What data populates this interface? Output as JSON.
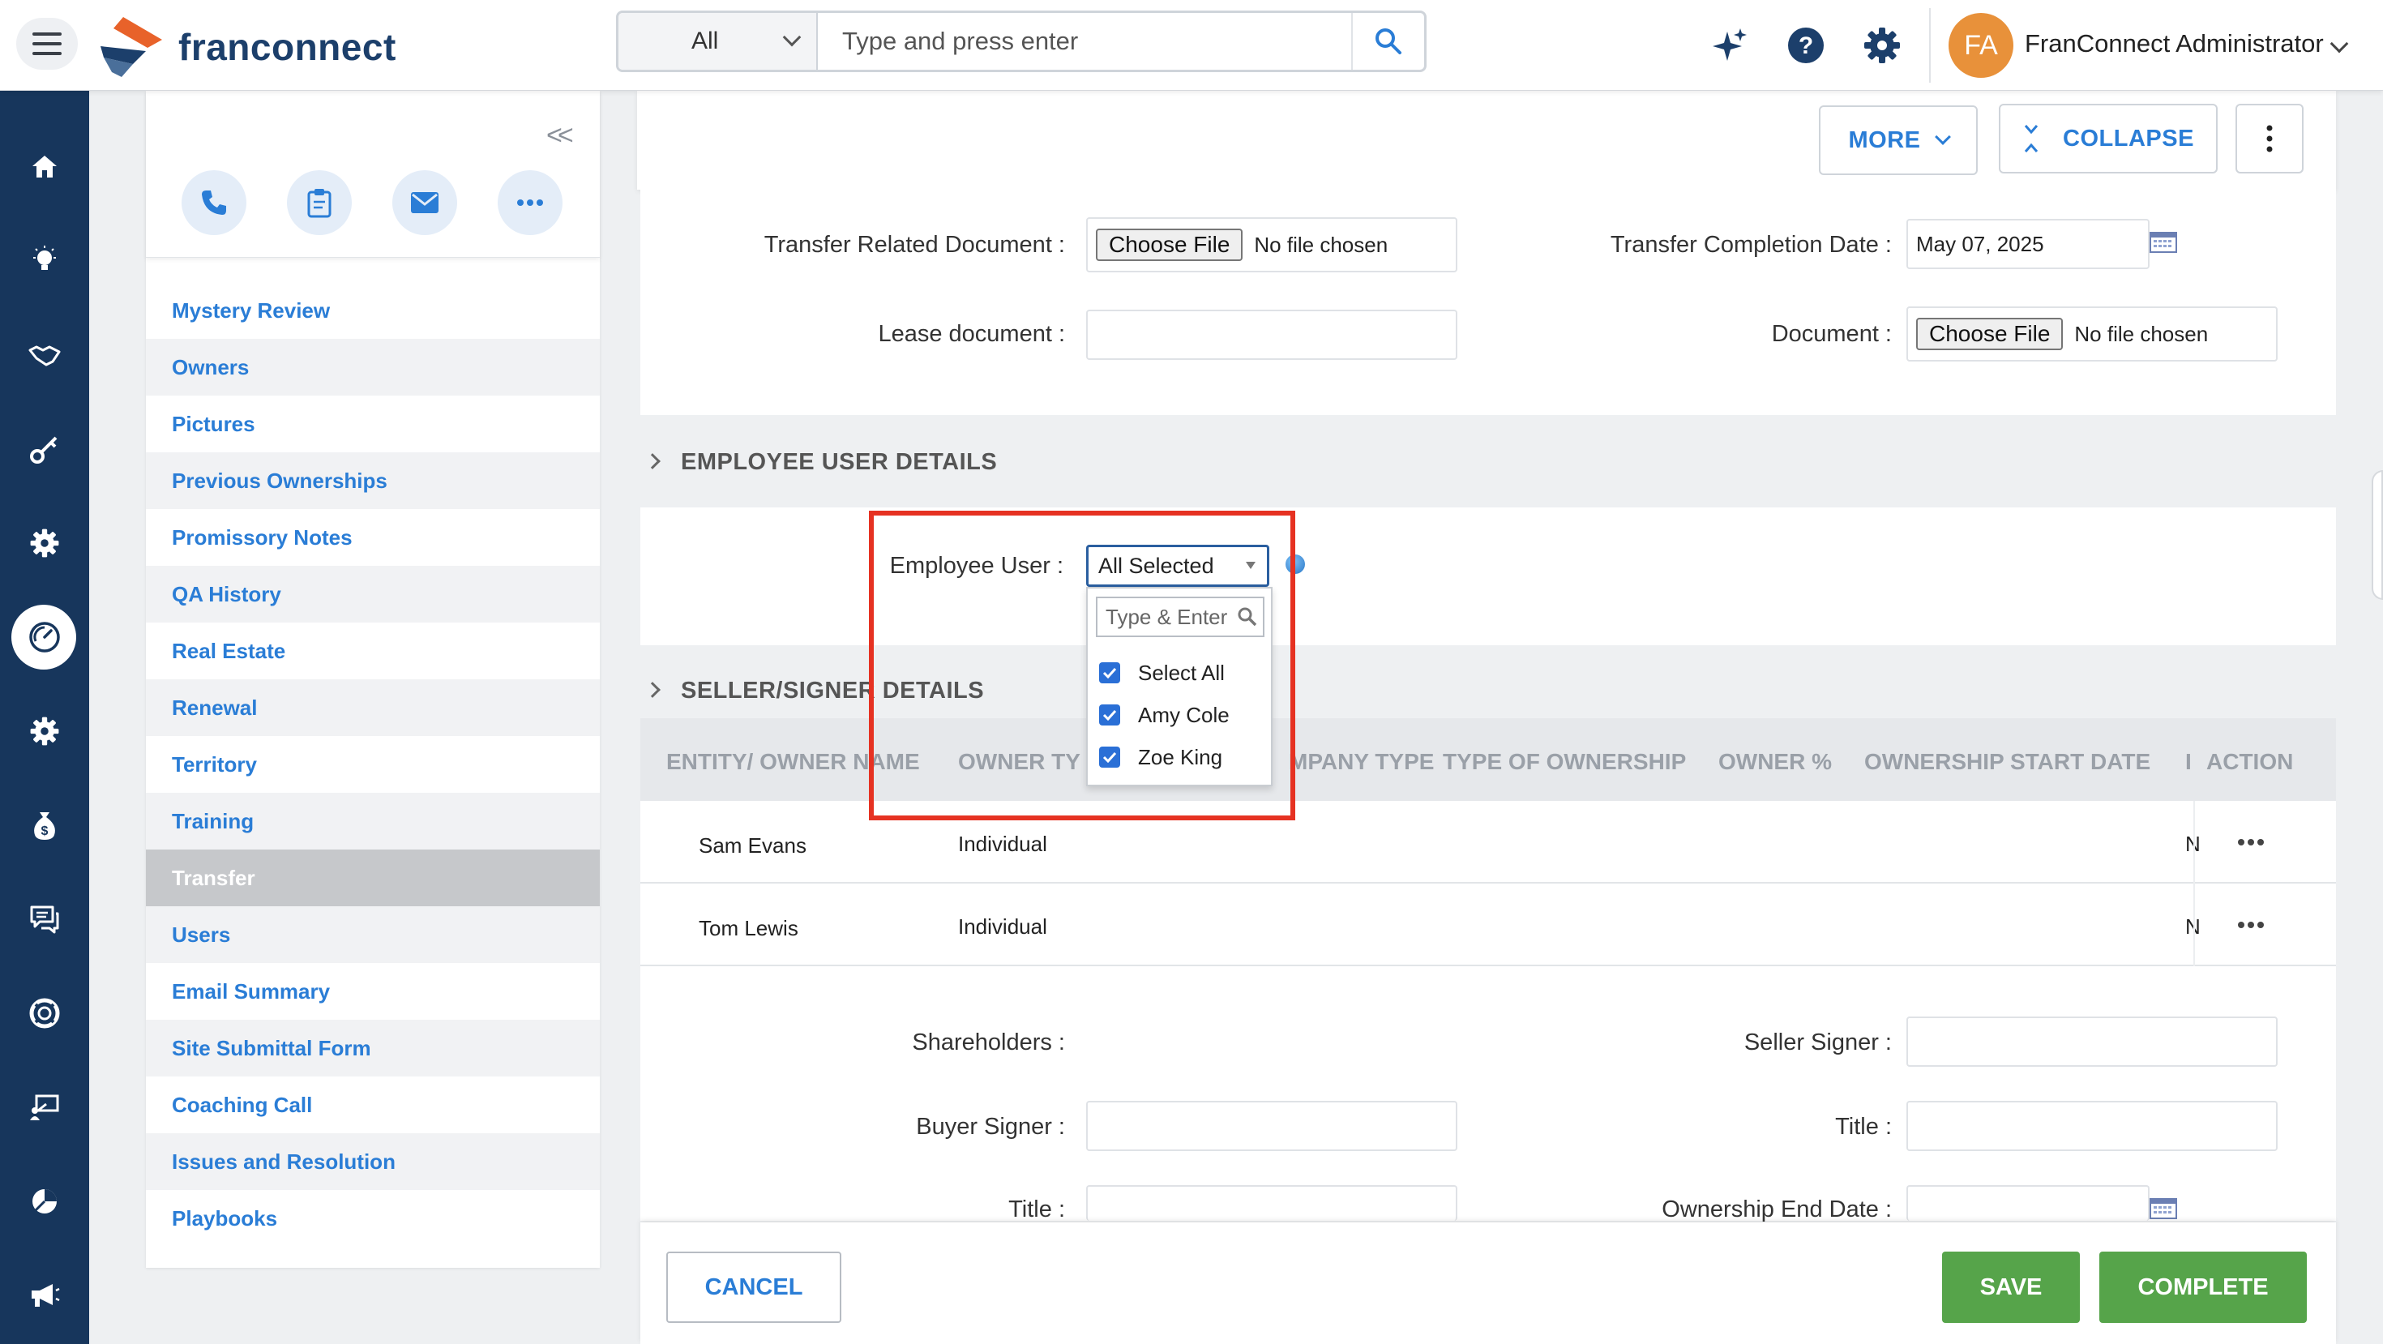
{
  "header": {
    "logo_text": "franconnect",
    "search_scope": "All",
    "search_placeholder": "Type and press enter",
    "user_initials": "FA",
    "user_name": "FranConnect Administrator",
    "icons": [
      "menu-icon",
      "sparkle-icon",
      "help-icon",
      "settings-icon",
      "search-icon"
    ]
  },
  "rail": {
    "items": [
      "home-icon",
      "lightbulb-icon",
      "handshake-icon",
      "key-icon",
      "gear-icon",
      "dashboard-icon",
      "gear-icon",
      "money-bag-icon",
      "chat-icon",
      "support-icon",
      "training-icon",
      "pie-chart-icon",
      "megaphone-icon"
    ],
    "active_index": 5
  },
  "subpanel": {
    "collapse_glyph": "<<",
    "actions": [
      "phone-icon",
      "clipboard-icon",
      "mail-icon",
      "more-icon"
    ],
    "items": [
      {
        "label": "Mystery Review"
      },
      {
        "label": "Owners"
      },
      {
        "label": "Pictures"
      },
      {
        "label": "Previous Ownerships"
      },
      {
        "label": "Promissory Notes"
      },
      {
        "label": "QA History"
      },
      {
        "label": "Real Estate"
      },
      {
        "label": "Renewal"
      },
      {
        "label": "Territory"
      },
      {
        "label": "Training"
      },
      {
        "label": "Transfer"
      },
      {
        "label": "Users"
      },
      {
        "label": "Email Summary"
      },
      {
        "label": "Site Submittal Form"
      },
      {
        "label": "Coaching Call"
      },
      {
        "label": "Issues and Resolution"
      },
      {
        "label": "Playbooks"
      }
    ],
    "active_label": "Transfer"
  },
  "toolbar": {
    "more_label": "MORE",
    "collapse_label": "COLLAPSE"
  },
  "transfer_form": {
    "related_doc_label": "Transfer Related Document :",
    "choose_file": "Choose File",
    "no_file": "No file chosen",
    "completion_date_label": "Transfer Completion Date :",
    "completion_date_value": "May 07, 2025",
    "lease_doc_label": "Lease document :",
    "document_label": "Document :"
  },
  "employee_section": {
    "title": "EMPLOYEE USER DETAILS",
    "field_label": "Employee User :",
    "selected_value": "All Selected",
    "search_placeholder": "Type & Enter",
    "options": [
      {
        "label": "Select All",
        "checked": true
      },
      {
        "label": "Amy Cole",
        "checked": true
      },
      {
        "label": "Zoe King",
        "checked": true
      }
    ]
  },
  "seller_section": {
    "title": "SELLER/SIGNER DETAILS",
    "columns": [
      "ENTITY/ OWNER NAME",
      "OWNER TY",
      "MPANY TYPE",
      "TYPE OF OWNERSHIP",
      "OWNER %",
      "OWNERSHIP START DATE",
      "I",
      "ACTION"
    ],
    "rows": [
      {
        "name": "Sam Evans",
        "owner_type": "Individual",
        "trunc": "N"
      },
      {
        "name": "Tom Lewis",
        "owner_type": "Individual",
        "trunc": "N"
      }
    ],
    "shareholders_label": "Shareholders :",
    "seller_signer_label": "Seller Signer :",
    "buyer_signer_label": "Buyer Signer :",
    "title_label": "Title :",
    "title_label_2": "Title :",
    "ownership_end_label": "Ownership End Date :"
  },
  "footer": {
    "cancel_label": "CANCEL",
    "save_label": "SAVE",
    "complete_label": "COMPLETE"
  },
  "colors": {
    "rail_bg": "#17365c",
    "link_blue": "#2a7dd6",
    "green": "#56a44a",
    "highlight_red": "#e63222",
    "avatar_orange": "#e8913a"
  }
}
